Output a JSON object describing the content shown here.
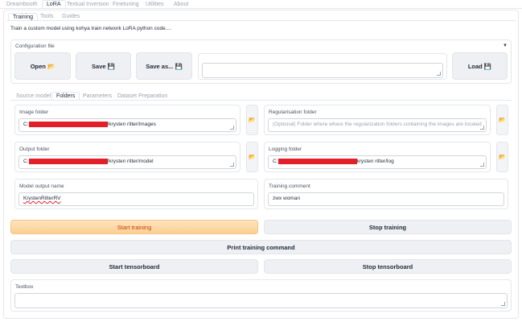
{
  "top_tabs": [
    "Dreambooth",
    "LoRA",
    "Textual Inversion",
    "Finetuning",
    "Utilities",
    "About"
  ],
  "sub_tabs": [
    "Training",
    "Tools",
    "Guides"
  ],
  "description": "Train a custom model using kohya train network LoRA python code....",
  "config": {
    "header": "Configuration file",
    "open_label": "Open 📂",
    "save_label": "Save 💾",
    "save_as_label": "Save as... 💾",
    "load_label": "Load 💾",
    "value": ""
  },
  "inner_tabs": [
    "Source model",
    "Folders",
    "Parameters",
    "Dataset Preparation"
  ],
  "folders": {
    "image_label": "Image folder",
    "image_prefix": "C:",
    "image_suffix": "/krysten ritter/images",
    "reg_label": "Regularisation folder",
    "reg_placeholder": "(Optional) Folder where where the regularization folders containing the images are located",
    "output_label": "Output folder",
    "output_prefix": "C:",
    "output_suffix": "/krysten ritter/model",
    "logging_label": "Logging folder",
    "logging_prefix": "C:",
    "logging_suffix": "krysten ritter/log",
    "model_name_label": "Model output name",
    "model_name_value": "KrystenRitterRV",
    "comment_label": "Training comment",
    "comment_value": "zwx woman",
    "folder_icon": "📂"
  },
  "actions": {
    "start_training": "Start training",
    "stop_training": "Stop training",
    "print_command": "Print training command",
    "start_tb": "Start tensorboard",
    "stop_tb": "Stop tensorboard"
  },
  "textbox": {
    "label": "Textbox",
    "value": ""
  },
  "colors": {
    "orange_text": "#c2410c",
    "redaction": "#e3202a"
  }
}
